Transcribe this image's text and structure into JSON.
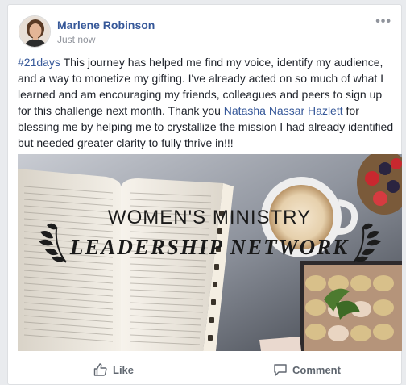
{
  "post": {
    "author": "Marlene Robinson",
    "timestamp": "Just now",
    "text": {
      "hashtag": "#21days",
      "part1": " This journey has helped me find my voice, identify my audience, and a way to monetize my gifting. I've already acted on so much of what I learned and am encouraging my friends, colleagues and peers to sign up for this challenge next month. Thank you ",
      "mention": "Natasha Nassar Hazlett",
      "part2": " for blessing me by helping me to crystallize the mission I had already identified but needed greater clarity to fully thrive in!!!"
    },
    "image": {
      "line1": "WOMEN'S MINISTRY",
      "line2": "LEADERSHIP NETWORK"
    },
    "more_label": "•••",
    "actions": {
      "like": "Like",
      "comment": "Comment"
    }
  },
  "colors": {
    "link": "#365899",
    "text": "#1d2129",
    "meta": "#90949c",
    "action": "#606770"
  }
}
